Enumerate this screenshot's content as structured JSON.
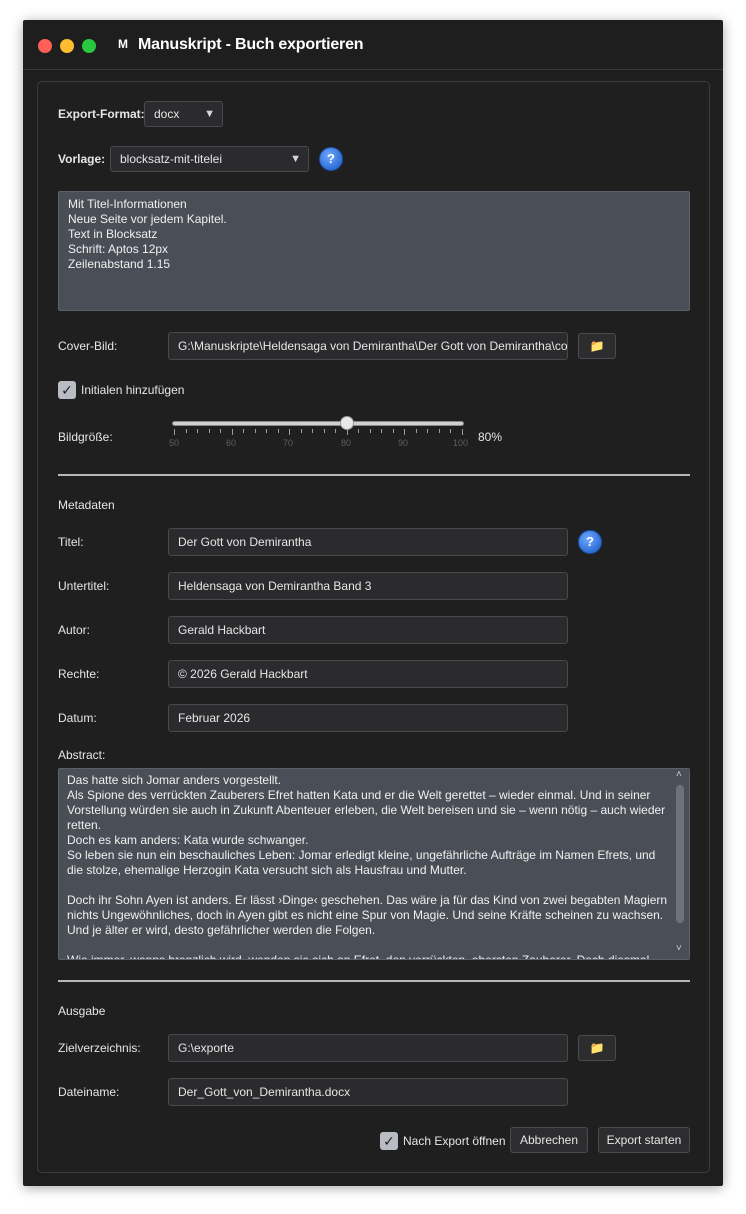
{
  "window": {
    "app_icon": "M",
    "title": "Manuskript - Buch exportieren"
  },
  "export": {
    "format_label": "Export-Format:",
    "format_value": "docx",
    "template_label": "Vorlage:",
    "template_value": "blocksatz-mit-titelei",
    "help_glyph": "?",
    "template_description": "Mit Titel-Informationen\nNeue Seite vor jedem Kapitel.\nText in Blocksatz\nSchrift: Aptos 12px\nZeilenabstand 1.15",
    "cover_label": "Cover-Bild:",
    "cover_path": "G:\\Manuskripte\\Heldensaga von Demirantha\\Der Gott von Demirantha\\cover",
    "initials_label": "Initialen hinzufügen",
    "initials_checked": true,
    "image_size_label": "Bildgröße:",
    "image_size_value": 80,
    "image_size_text": "80%",
    "slider_ticks": [
      "50",
      "60",
      "70",
      "80",
      "90",
      "100"
    ]
  },
  "metadata": {
    "section_title": "Metadaten",
    "title_label": "Titel:",
    "title_value": "Der Gott von Demirantha",
    "subtitle_label": "Untertitel:",
    "subtitle_value": "Heldensaga von Demirantha Band 3",
    "author_label": "Autor:",
    "author_value": "Gerald Hackbart",
    "rights_label": "Rechte:",
    "rights_value": "© 2026 Gerald Hackbart",
    "date_label": "Datum:",
    "date_value": "Februar 2026",
    "abstract_label": "Abstract:",
    "abstract_text": "Das hatte sich Jomar anders vorgestellt.\nAls Spione des verrückten Zauberers Efret hatten Kata und er die Welt gerettet – wieder einmal. Und in seiner Vorstellung würden sie auch in Zukunft Abenteuer erleben, die Welt bereisen und sie – wenn nötig – auch wieder retten.\nDoch es kam anders: Kata wurde schwanger.\nSo leben sie nun ein beschauliches Leben: Jomar erledigt kleine, ungefährliche Aufträge im Namen Efrets, und die stolze, ehemalige Herzogin Kata versucht sich als Hausfrau und Mutter.\n\nDoch ihr Sohn Ayen ist anders. Er lässt ›Dinge‹ geschehen. Das wäre ja für das Kind von zwei begabten Magiern nichts Ungewöhnliches, doch in Ayen gibt es nicht eine Spur von Magie. Und seine Kräfte scheinen zu wachsen. Und je älter er wird, desto gefährlicher werden die Folgen.\n\nWie immer, wenns brenzlich wird, wenden sie sich an Efret, den verrückten, obersten Zauberer. Doch diesmal geht es nicht darum, die Welt zu retten, es geht um ihren Sohn."
  },
  "output": {
    "section_title": "Ausgabe",
    "target_dir_label": "Zielverzeichnis:",
    "target_dir_value": "G:\\exporte",
    "filename_label": "Dateiname:",
    "filename_value": "Der_Gott_von_Demirantha.docx",
    "open_after_label": "Nach Export öffnen",
    "open_after_checked": true,
    "cancel_label": "Abbrechen",
    "start_label": "Export starten"
  },
  "icons": {
    "folder": "📁",
    "dropdown_arrow": "▼",
    "check": "✓",
    "scroll_up": "˄",
    "scroll_down": "˅"
  },
  "colors": {
    "accent_help": "#2e6fd6",
    "traffic_red": "#ff5f57",
    "traffic_yellow": "#febc2e",
    "traffic_green": "#28c840"
  }
}
